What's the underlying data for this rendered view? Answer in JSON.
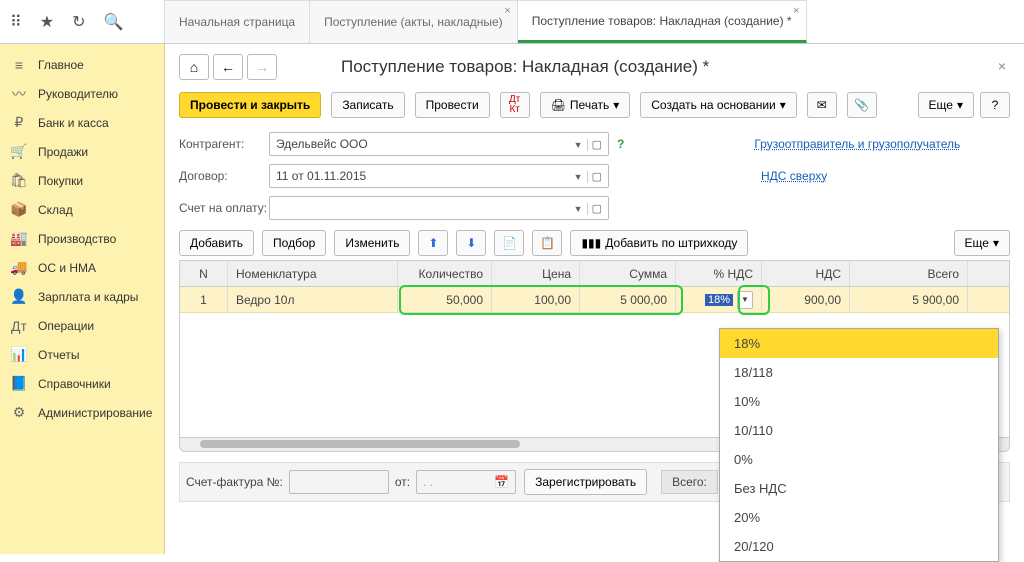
{
  "tabs": [
    {
      "label": "Начальная страница",
      "close": false
    },
    {
      "label": "Поступление (акты, накладные)",
      "close": true
    },
    {
      "label": "Поступление товаров: Накладная (создание) *",
      "close": true,
      "active": true
    }
  ],
  "sidebar": [
    {
      "icon": "≡",
      "label": "Главное"
    },
    {
      "icon": "〰",
      "label": "Руководителю"
    },
    {
      "icon": "₽",
      "label": "Банк и касса"
    },
    {
      "icon": "🛒",
      "label": "Продажи"
    },
    {
      "icon": "🛍",
      "label": "Покупки"
    },
    {
      "icon": "📦",
      "label": "Склад"
    },
    {
      "icon": "🏭",
      "label": "Производство"
    },
    {
      "icon": "🚚",
      "label": "ОС и НМА"
    },
    {
      "icon": "👤",
      "label": "Зарплата и кадры"
    },
    {
      "icon": "Дт",
      "label": "Операции"
    },
    {
      "icon": "📊",
      "label": "Отчеты"
    },
    {
      "icon": "📘",
      "label": "Справочники"
    },
    {
      "icon": "⚙",
      "label": "Администрирование"
    }
  ],
  "title": "Поступление товаров: Накладная (создание) *",
  "toolbar": {
    "post_close": "Провести и закрыть",
    "write": "Записать",
    "post": "Провести",
    "print": "Печать",
    "create_based": "Создать на основании",
    "more": "Еще"
  },
  "form": {
    "counterparty_label": "Контрагент:",
    "counterparty": "Эдельвейс ООО",
    "contract_label": "Договор:",
    "contract": "11 от 01.11.2015",
    "invoice_label": "Счет на оплату:",
    "link_ship": "Грузоотправитель и грузополучатель",
    "link_nds": "НДС сверху"
  },
  "tbl_toolbar": {
    "add": "Добавить",
    "pick": "Подбор",
    "edit": "Изменить",
    "barcode": "Добавить по штрихкоду",
    "more": "Еще"
  },
  "grid": {
    "headers": {
      "n": "N",
      "nom": "Номенклатура",
      "qty": "Количество",
      "price": "Цена",
      "sum": "Сумма",
      "nds": "% НДС",
      "ndsval": "НДС",
      "total": "Всего"
    },
    "row": {
      "n": "1",
      "nom": "Ведро 10л",
      "qty": "50,000",
      "price": "100,00",
      "sum": "5 000,00",
      "nds": "18%",
      "ndsval": "900,00",
      "total": "5 900,00"
    }
  },
  "dropdown": [
    "18%",
    "18/118",
    "10%",
    "10/110",
    "0%",
    "Без НДС",
    "20%",
    "20/120"
  ],
  "bottom": {
    "sf_label": "Счет-фактура №:",
    "from": "от:",
    "date_ph": ".  .",
    "register": "Зарегистрировать",
    "total_label": "Всего:"
  }
}
